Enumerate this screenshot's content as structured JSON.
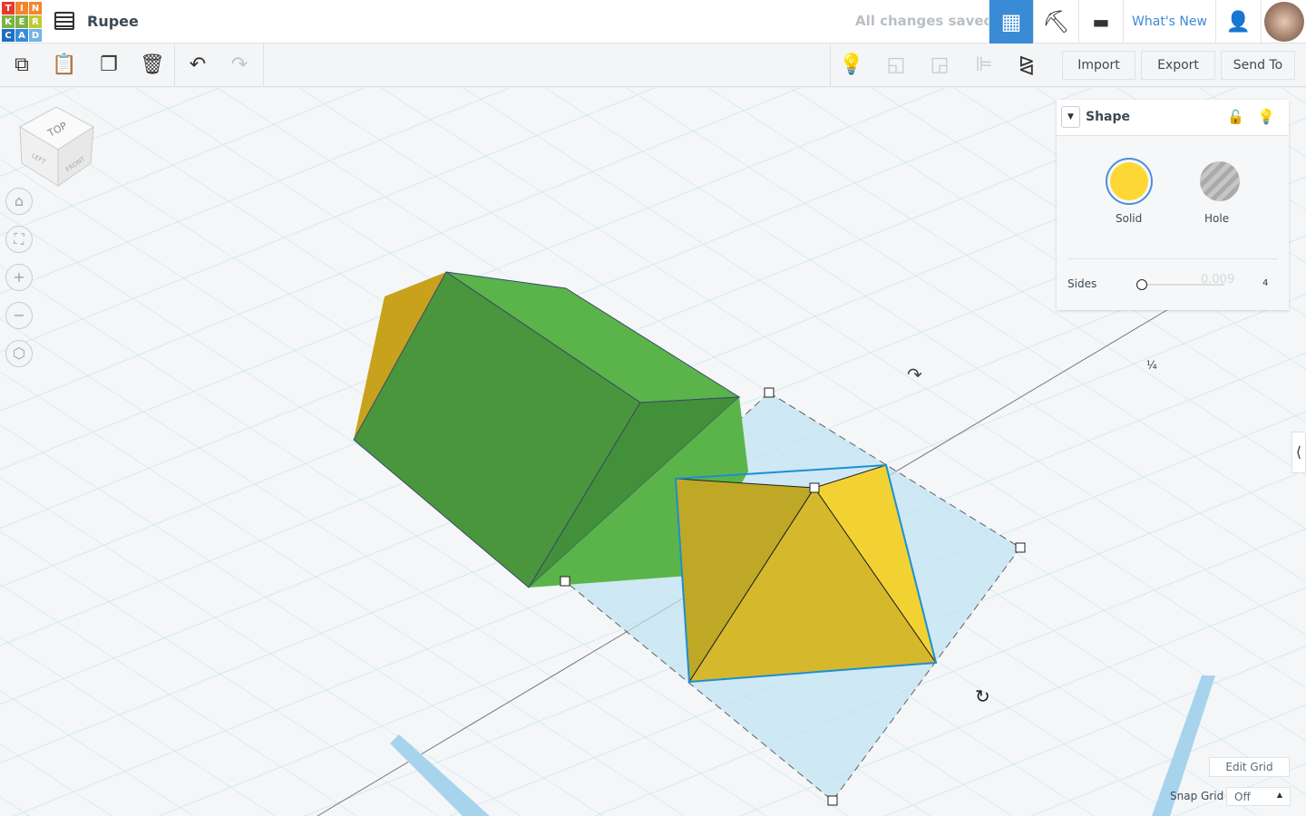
{
  "header": {
    "logo_letters": [
      "T",
      "I",
      "N",
      "K",
      "E",
      "R",
      "C",
      "A",
      "D"
    ],
    "title": "Rupee",
    "save_status": "All changes saved",
    "whats_new": "What's New"
  },
  "toolbar": {
    "import": "Import",
    "export": "Export",
    "send_to": "Send To"
  },
  "shape_panel": {
    "title": "Shape",
    "solid": "Solid",
    "hole": "Hole",
    "sides_label": "Sides",
    "sides_value": "4",
    "sides_hint": "0.009",
    "solid_color": "#fdd835"
  },
  "grid": {
    "edit_grid": "Edit Grid",
    "snap_grid_label": "Snap Grid",
    "snap_grid_value": "Off",
    "scale_mark": "¼"
  },
  "viewcube": {
    "top": "TOP",
    "left": "LEFT",
    "front": "FRONT"
  }
}
